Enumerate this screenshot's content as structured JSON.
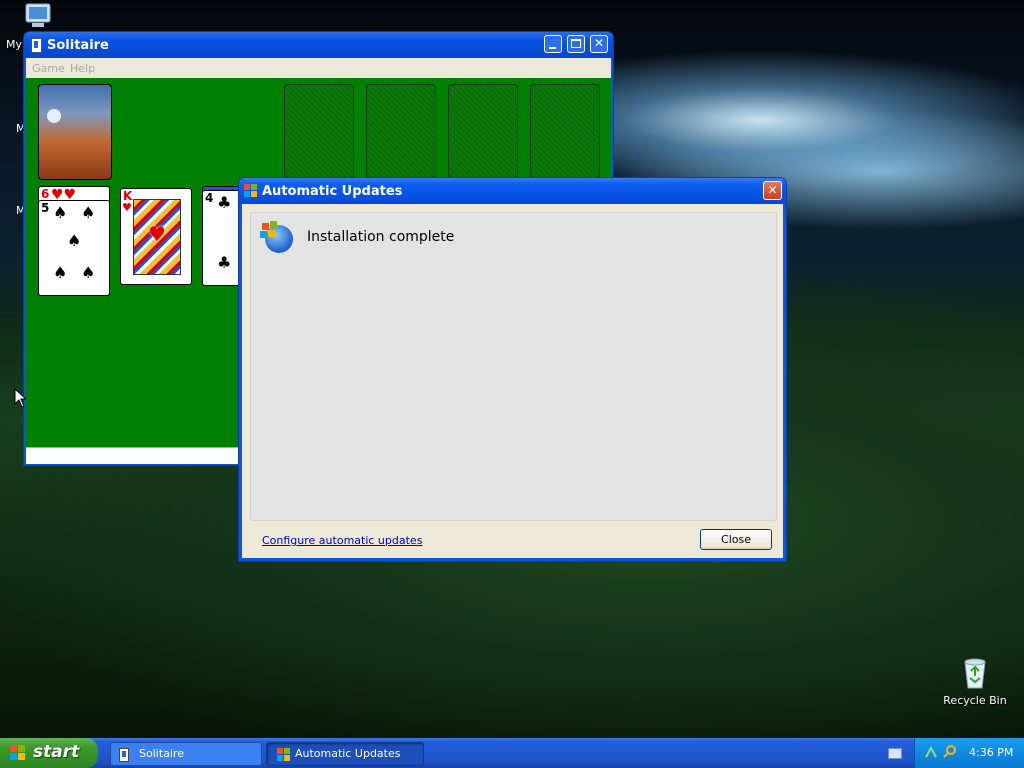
{
  "desktop": {
    "icons": [
      {
        "label": "My",
        "name": "my-computer"
      },
      {
        "label": "Recycle Bin",
        "name": "recycle-bin"
      }
    ]
  },
  "solitaire": {
    "title": "Solitaire",
    "menu": [
      "Game",
      "Help"
    ],
    "tableau": [
      {
        "rank_top": "6",
        "suit": "hearts"
      },
      {
        "rank_top": "5",
        "suit": "spades"
      },
      {
        "rank_top": "K",
        "suit": "hearts"
      },
      {
        "rank_top": "4",
        "suit": "clubs"
      }
    ]
  },
  "dialog": {
    "title": "Automatic Updates",
    "message": "Installation complete",
    "link": "Configure automatic updates",
    "close_label": "Close"
  },
  "taskbar": {
    "start_label": "start",
    "buttons": [
      {
        "label": "Solitaire"
      },
      {
        "label": "Automatic Updates"
      }
    ],
    "clock": "4:36 PM"
  },
  "colors": {
    "xp_blue": "#0a54e6",
    "felt_green": "#008000",
    "start_green": "#3c9a2c",
    "dialog_bg": "#ece9d8"
  }
}
